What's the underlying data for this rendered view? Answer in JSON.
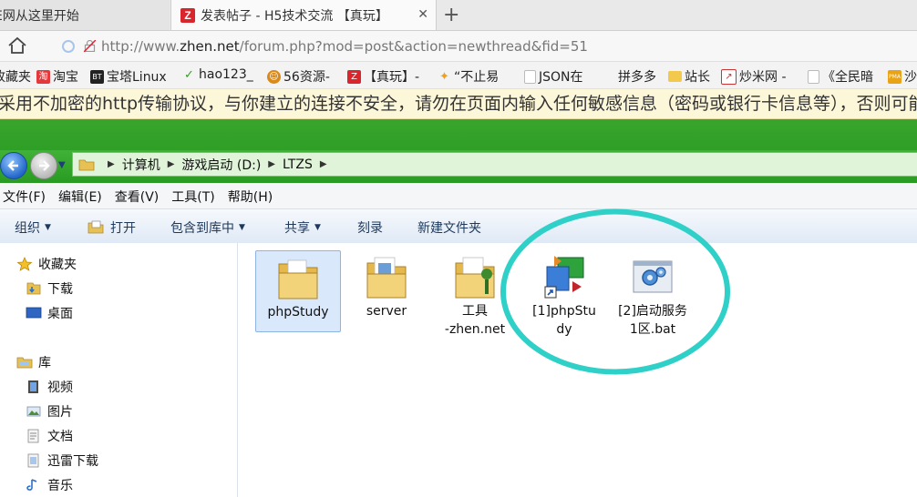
{
  "browser": {
    "tabs": [
      {
        "title": "E网从这里开始",
        "active": false
      },
      {
        "title": "发表帖子 - H5技术交流 【真玩】",
        "active": true,
        "favicon": "Z"
      }
    ],
    "new_tab_glyph": "+",
    "close_glyph": "✕",
    "url_prefix": "http://www.",
    "url_domain": "zhen.net",
    "url_suffix": "/forum.php?mod=post&action=newthread&fid=51",
    "bookmarks": [
      {
        "label": "收藏夹",
        "icon": "star-icon"
      },
      {
        "label": "淘宝",
        "icon": "taobao-icon",
        "icon_text": "淘"
      },
      {
        "label": "宝塔Linux",
        "icon": "bt-icon",
        "icon_text": "BT"
      },
      {
        "label": "hao123_",
        "icon": "hao123-icon"
      },
      {
        "label": "56资源-",
        "icon": "56-icon"
      },
      {
        "label": "【真玩】-",
        "icon": "zhen-icon",
        "icon_text": "Z"
      },
      {
        "label": "“不止易",
        "icon": "flame-icon"
      },
      {
        "label": "JSON在",
        "icon": "page-icon"
      },
      {
        "label": "拼多多",
        "icon": "blank-icon"
      },
      {
        "label": "站长",
        "icon": "folder-icon"
      },
      {
        "label": "炒米网 -",
        "icon": "chart-icon"
      },
      {
        "label": "《全民暗",
        "icon": "page-icon"
      },
      {
        "label": "沙",
        "icon": "pma-icon",
        "icon_text": "PMA"
      }
    ],
    "warning": "采用不加密的http传输协议，与你建立的连接不安全，请勿在页面内输入任何敏感信息（密码或银行卡信息等），否则可能"
  },
  "explorer": {
    "breadcrumb": [
      "计算机",
      "游戏启动 (D:)",
      "LTZS"
    ],
    "menu": [
      "文件(F)",
      "编辑(E)",
      "查看(V)",
      "工具(T)",
      "帮助(H)"
    ],
    "toolbar": {
      "organize": "组织",
      "open": "打开",
      "include_library": "包含到库中",
      "share": "共享",
      "burn": "刻录",
      "new_folder": "新建文件夹"
    },
    "nav": {
      "favorites": "收藏夹",
      "downloads": "下载",
      "desktop": "桌面",
      "libraries": "库",
      "videos": "视频",
      "pictures": "图片",
      "documents": "文档",
      "xunlei": "迅雷下载",
      "music": "音乐"
    },
    "files": [
      {
        "name": "phpStudy",
        "icon": "folder-icon",
        "selected": true
      },
      {
        "name": "server",
        "icon": "folder-doc-icon",
        "selected": false
      },
      {
        "name": "工具\n-zhen.net",
        "icon": "folder-tools-icon",
        "selected": false
      },
      {
        "name": "[1]phpStu\ndy",
        "icon": "shortcut-app-icon",
        "selected": false
      },
      {
        "name": "[2]启动服务\n1区.bat",
        "icon": "bat-gear-icon",
        "selected": false
      }
    ],
    "annotation_color": "#2fd0c8"
  }
}
